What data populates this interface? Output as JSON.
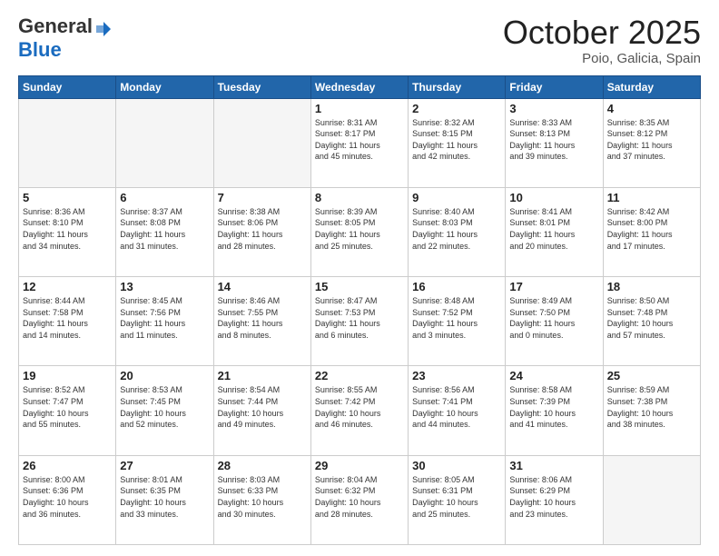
{
  "header": {
    "logo_general": "General",
    "logo_blue": "Blue",
    "month_title": "October 2025",
    "location": "Poio, Galicia, Spain"
  },
  "weekdays": [
    "Sunday",
    "Monday",
    "Tuesday",
    "Wednesday",
    "Thursday",
    "Friday",
    "Saturday"
  ],
  "weeks": [
    [
      {
        "day": "",
        "info": ""
      },
      {
        "day": "",
        "info": ""
      },
      {
        "day": "",
        "info": ""
      },
      {
        "day": "1",
        "info": "Sunrise: 8:31 AM\nSunset: 8:17 PM\nDaylight: 11 hours\nand 45 minutes."
      },
      {
        "day": "2",
        "info": "Sunrise: 8:32 AM\nSunset: 8:15 PM\nDaylight: 11 hours\nand 42 minutes."
      },
      {
        "day": "3",
        "info": "Sunrise: 8:33 AM\nSunset: 8:13 PM\nDaylight: 11 hours\nand 39 minutes."
      },
      {
        "day": "4",
        "info": "Sunrise: 8:35 AM\nSunset: 8:12 PM\nDaylight: 11 hours\nand 37 minutes."
      }
    ],
    [
      {
        "day": "5",
        "info": "Sunrise: 8:36 AM\nSunset: 8:10 PM\nDaylight: 11 hours\nand 34 minutes."
      },
      {
        "day": "6",
        "info": "Sunrise: 8:37 AM\nSunset: 8:08 PM\nDaylight: 11 hours\nand 31 minutes."
      },
      {
        "day": "7",
        "info": "Sunrise: 8:38 AM\nSunset: 8:06 PM\nDaylight: 11 hours\nand 28 minutes."
      },
      {
        "day": "8",
        "info": "Sunrise: 8:39 AM\nSunset: 8:05 PM\nDaylight: 11 hours\nand 25 minutes."
      },
      {
        "day": "9",
        "info": "Sunrise: 8:40 AM\nSunset: 8:03 PM\nDaylight: 11 hours\nand 22 minutes."
      },
      {
        "day": "10",
        "info": "Sunrise: 8:41 AM\nSunset: 8:01 PM\nDaylight: 11 hours\nand 20 minutes."
      },
      {
        "day": "11",
        "info": "Sunrise: 8:42 AM\nSunset: 8:00 PM\nDaylight: 11 hours\nand 17 minutes."
      }
    ],
    [
      {
        "day": "12",
        "info": "Sunrise: 8:44 AM\nSunset: 7:58 PM\nDaylight: 11 hours\nand 14 minutes."
      },
      {
        "day": "13",
        "info": "Sunrise: 8:45 AM\nSunset: 7:56 PM\nDaylight: 11 hours\nand 11 minutes."
      },
      {
        "day": "14",
        "info": "Sunrise: 8:46 AM\nSunset: 7:55 PM\nDaylight: 11 hours\nand 8 minutes."
      },
      {
        "day": "15",
        "info": "Sunrise: 8:47 AM\nSunset: 7:53 PM\nDaylight: 11 hours\nand 6 minutes."
      },
      {
        "day": "16",
        "info": "Sunrise: 8:48 AM\nSunset: 7:52 PM\nDaylight: 11 hours\nand 3 minutes."
      },
      {
        "day": "17",
        "info": "Sunrise: 8:49 AM\nSunset: 7:50 PM\nDaylight: 11 hours\nand 0 minutes."
      },
      {
        "day": "18",
        "info": "Sunrise: 8:50 AM\nSunset: 7:48 PM\nDaylight: 10 hours\nand 57 minutes."
      }
    ],
    [
      {
        "day": "19",
        "info": "Sunrise: 8:52 AM\nSunset: 7:47 PM\nDaylight: 10 hours\nand 55 minutes."
      },
      {
        "day": "20",
        "info": "Sunrise: 8:53 AM\nSunset: 7:45 PM\nDaylight: 10 hours\nand 52 minutes."
      },
      {
        "day": "21",
        "info": "Sunrise: 8:54 AM\nSunset: 7:44 PM\nDaylight: 10 hours\nand 49 minutes."
      },
      {
        "day": "22",
        "info": "Sunrise: 8:55 AM\nSunset: 7:42 PM\nDaylight: 10 hours\nand 46 minutes."
      },
      {
        "day": "23",
        "info": "Sunrise: 8:56 AM\nSunset: 7:41 PM\nDaylight: 10 hours\nand 44 minutes."
      },
      {
        "day": "24",
        "info": "Sunrise: 8:58 AM\nSunset: 7:39 PM\nDaylight: 10 hours\nand 41 minutes."
      },
      {
        "day": "25",
        "info": "Sunrise: 8:59 AM\nSunset: 7:38 PM\nDaylight: 10 hours\nand 38 minutes."
      }
    ],
    [
      {
        "day": "26",
        "info": "Sunrise: 8:00 AM\nSunset: 6:36 PM\nDaylight: 10 hours\nand 36 minutes."
      },
      {
        "day": "27",
        "info": "Sunrise: 8:01 AM\nSunset: 6:35 PM\nDaylight: 10 hours\nand 33 minutes."
      },
      {
        "day": "28",
        "info": "Sunrise: 8:03 AM\nSunset: 6:33 PM\nDaylight: 10 hours\nand 30 minutes."
      },
      {
        "day": "29",
        "info": "Sunrise: 8:04 AM\nSunset: 6:32 PM\nDaylight: 10 hours\nand 28 minutes."
      },
      {
        "day": "30",
        "info": "Sunrise: 8:05 AM\nSunset: 6:31 PM\nDaylight: 10 hours\nand 25 minutes."
      },
      {
        "day": "31",
        "info": "Sunrise: 8:06 AM\nSunset: 6:29 PM\nDaylight: 10 hours\nand 23 minutes."
      },
      {
        "day": "",
        "info": ""
      }
    ]
  ]
}
